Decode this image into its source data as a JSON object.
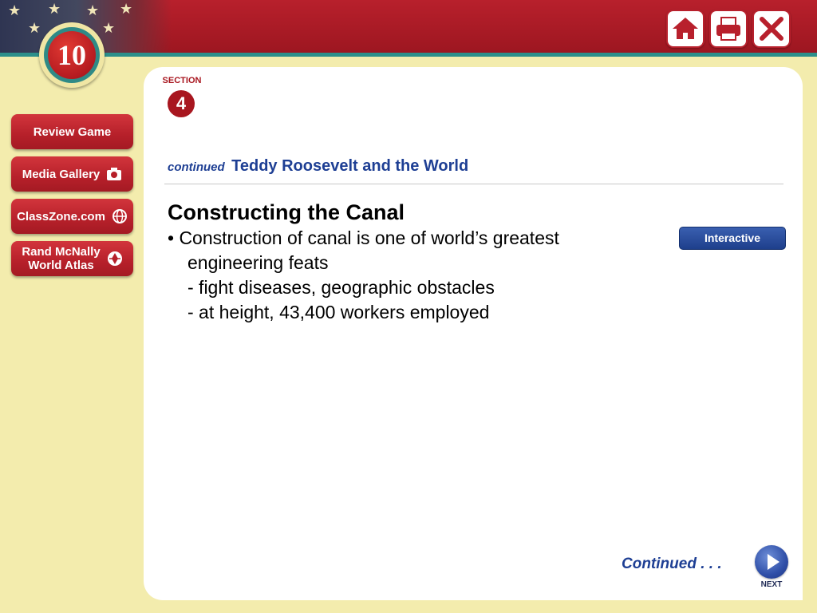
{
  "chapter": {
    "number": "10"
  },
  "toolbar": {
    "home_icon": "home-icon",
    "print_icon": "printer-icon",
    "close_icon": "close-icon"
  },
  "sidebar": {
    "items": [
      {
        "label": "Review Game",
        "icon": ""
      },
      {
        "label": "Media Gallery",
        "icon": "camera-icon"
      },
      {
        "label": "ClassZone.com",
        "icon": "globe-icon"
      },
      {
        "label_line1": "Rand McNally",
        "label_line2": "World Atlas",
        "icon": "atlas-icon"
      }
    ]
  },
  "section": {
    "label": "SECTION",
    "number": "4"
  },
  "header": {
    "continued": "continued",
    "title": "Teddy Roosevelt and the World"
  },
  "content": {
    "title": "Constructing the Canal",
    "bullet_line1": "• Construction of canal is one of world’s greatest",
    "bullet_line2": "engineering feats",
    "sub1": "- fight diseases, geographic obstacles",
    "sub2": "- at height, 43,400 workers employed"
  },
  "interactive_button": {
    "label": "Interactive"
  },
  "footer": {
    "continued": "Continued . . .",
    "next_label": "NEXT"
  },
  "colors": {
    "background": "#f3ecad",
    "banner_red": "#b8202c",
    "teal": "#2d8f8a",
    "title_blue": "#1e3f94",
    "section_red": "#a8161f"
  }
}
